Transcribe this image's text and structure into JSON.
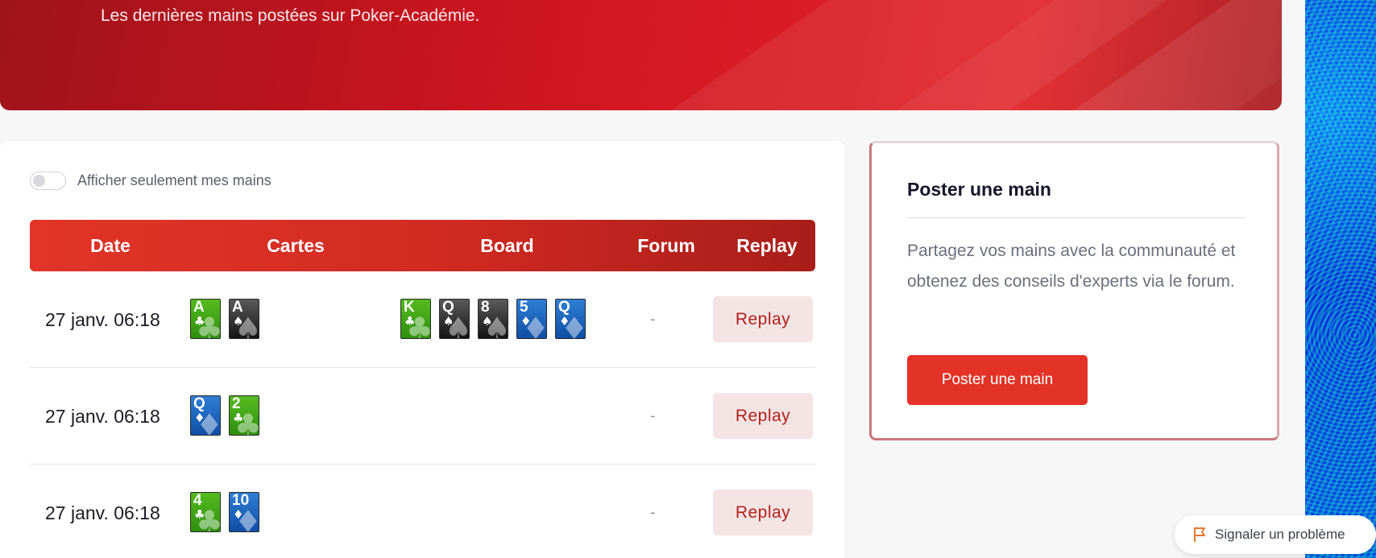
{
  "hero": {
    "subtitle": "Les dernières mains postées sur Poker-Académie."
  },
  "filter": {
    "toggle_label": "Afficher seulement mes mains",
    "toggle_on": false
  },
  "table": {
    "headers": [
      "Date",
      "Cartes",
      "Board",
      "Forum",
      "Replay"
    ],
    "rows": [
      {
        "date": "27 janv. 06:18",
        "cards": [
          {
            "rank": "A",
            "suit": "c"
          },
          {
            "rank": "A",
            "suit": "s"
          }
        ],
        "board": [
          {
            "rank": "K",
            "suit": "c"
          },
          {
            "rank": "Q",
            "suit": "s"
          },
          {
            "rank": "8",
            "suit": "s"
          },
          {
            "rank": "5",
            "suit": "d"
          },
          {
            "rank": "Q",
            "suit": "d"
          }
        ],
        "forum": "-",
        "replay": "Replay"
      },
      {
        "date": "27 janv. 06:18",
        "cards": [
          {
            "rank": "Q",
            "suit": "d"
          },
          {
            "rank": "2",
            "suit": "c"
          }
        ],
        "board": [],
        "forum": "-",
        "replay": "Replay"
      },
      {
        "date": "27 janv. 06:18",
        "cards": [
          {
            "rank": "4",
            "suit": "c"
          },
          {
            "rank": "10",
            "suit": "d"
          }
        ],
        "board": [],
        "forum": "-",
        "replay": "Replay"
      }
    ]
  },
  "side": {
    "title": "Poster une main",
    "text": "Partagez vos mains avec la communauté et obtenez des conseils d'experts via le forum.",
    "button": "Poster une main"
  },
  "report": {
    "label": "Signaler un problème",
    "icon": "flag-icon"
  },
  "colors": {
    "accent": "#e33327",
    "club": "#3fa617",
    "spade": "#2a2a2a",
    "diamond": "#1b63bf"
  },
  "suit_symbols": {
    "c": "♣",
    "s": "♠",
    "d": "♦"
  }
}
